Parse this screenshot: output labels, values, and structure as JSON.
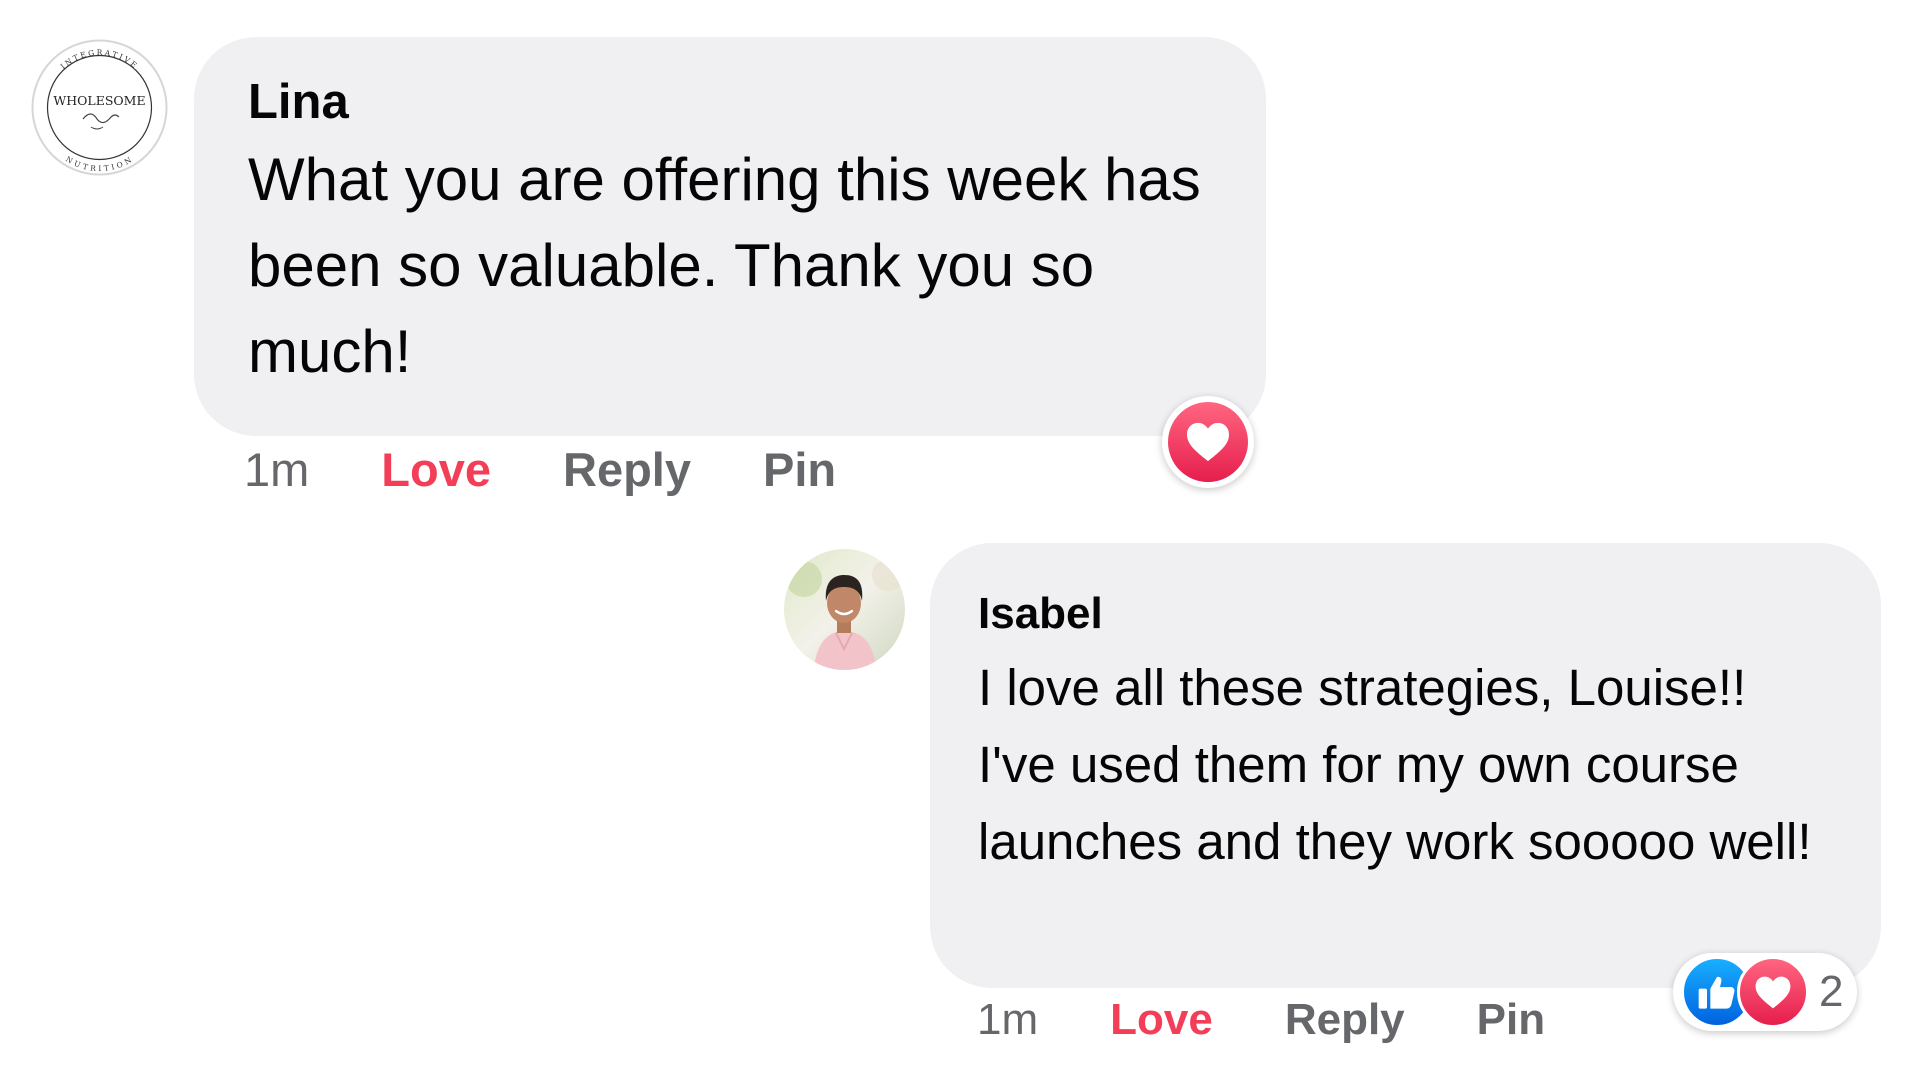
{
  "comments": [
    {
      "author": "Lina",
      "text": "What you are offering this week has been so valuable. Thank you so much!",
      "time": "1m",
      "actions": {
        "love": "Love",
        "reply": "Reply",
        "pin": "Pin"
      },
      "avatar": {
        "icon": "wholesome-logo-avatar",
        "logo_text": "WHOLESOME",
        "ring_text_top": "INTEGRATIVE",
        "ring_text_bottom": "NUTRITION"
      },
      "reactions": {
        "icons": [
          "love-reaction-icon"
        ]
      }
    },
    {
      "author": "Isabel",
      "text": "I love all these strategies, Louise!! I've used them for my own course launches and they work sooooo well!",
      "time": "1m",
      "actions": {
        "love": "Love",
        "reply": "Reply",
        "pin": "Pin"
      },
      "avatar": {
        "icon": "profile-photo-avatar"
      },
      "reactions": {
        "icons": [
          "like-reaction-icon",
          "love-reaction-icon"
        ],
        "count": "2"
      }
    }
  ],
  "colors": {
    "bubble": "#f0f0f3",
    "love_accent": "#f33e58",
    "meta_gray": "#65676b",
    "like_blue": "#0866ff"
  }
}
